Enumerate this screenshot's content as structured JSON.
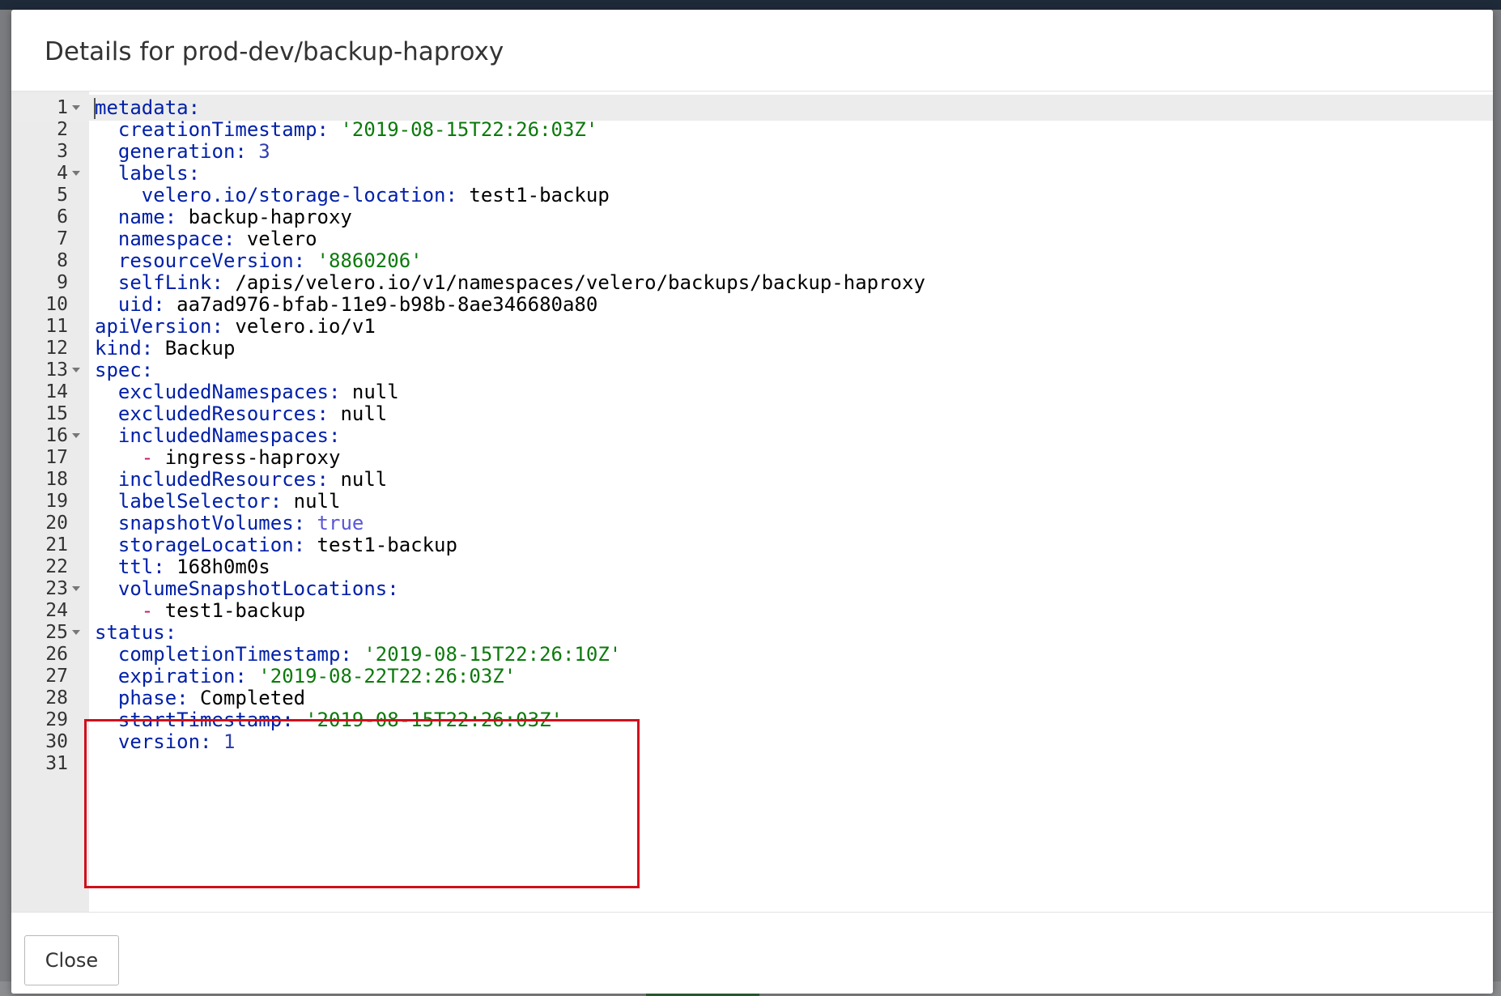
{
  "modal": {
    "title": "Details for prod-dev/backup-haproxy",
    "close_label": "Close"
  },
  "editor": {
    "lines": [
      {
        "n": "1",
        "fold": true,
        "parts": [
          {
            "t": "metadata:",
            "c": "k"
          }
        ]
      },
      {
        "n": "2",
        "fold": false,
        "parts": [
          {
            "t": "  creationTimestamp: ",
            "c": "k"
          },
          {
            "t": "'2019-08-15T22:26:03Z'",
            "c": "s"
          }
        ]
      },
      {
        "n": "3",
        "fold": false,
        "parts": [
          {
            "t": "  generation: ",
            "c": "k"
          },
          {
            "t": "3",
            "c": "n"
          }
        ]
      },
      {
        "n": "4",
        "fold": true,
        "parts": [
          {
            "t": "  labels:",
            "c": "k"
          }
        ]
      },
      {
        "n": "5",
        "fold": false,
        "parts": [
          {
            "t": "    velero.io/storage-location: ",
            "c": "k"
          },
          {
            "t": "test1-backup",
            "c": "p"
          }
        ]
      },
      {
        "n": "6",
        "fold": false,
        "parts": [
          {
            "t": "  name: ",
            "c": "k"
          },
          {
            "t": "backup-haproxy",
            "c": "p"
          }
        ]
      },
      {
        "n": "7",
        "fold": false,
        "parts": [
          {
            "t": "  namespace: ",
            "c": "k"
          },
          {
            "t": "velero",
            "c": "p"
          }
        ]
      },
      {
        "n": "8",
        "fold": false,
        "parts": [
          {
            "t": "  resourceVersion: ",
            "c": "k"
          },
          {
            "t": "'8860206'",
            "c": "s"
          }
        ]
      },
      {
        "n": "9",
        "fold": false,
        "parts": [
          {
            "t": "  selfLink: ",
            "c": "k"
          },
          {
            "t": "/apis/velero.io/v1/namespaces/velero/backups/backup-haproxy",
            "c": "p"
          }
        ]
      },
      {
        "n": "10",
        "fold": false,
        "parts": [
          {
            "t": "  uid: ",
            "c": "k"
          },
          {
            "t": "aa7ad976-bfab-11e9-b98b-8ae346680a80",
            "c": "p"
          }
        ]
      },
      {
        "n": "11",
        "fold": false,
        "parts": [
          {
            "t": "apiVersion: ",
            "c": "k"
          },
          {
            "t": "velero.io/v1",
            "c": "p"
          }
        ]
      },
      {
        "n": "12",
        "fold": false,
        "parts": [
          {
            "t": "kind: ",
            "c": "k"
          },
          {
            "t": "Backup",
            "c": "p"
          }
        ]
      },
      {
        "n": "13",
        "fold": true,
        "parts": [
          {
            "t": "spec:",
            "c": "k"
          }
        ]
      },
      {
        "n": "14",
        "fold": false,
        "parts": [
          {
            "t": "  excludedNamespaces: ",
            "c": "k"
          },
          {
            "t": "null",
            "c": "p"
          }
        ]
      },
      {
        "n": "15",
        "fold": false,
        "parts": [
          {
            "t": "  excludedResources: ",
            "c": "k"
          },
          {
            "t": "null",
            "c": "p"
          }
        ]
      },
      {
        "n": "16",
        "fold": true,
        "parts": [
          {
            "t": "  includedNamespaces:",
            "c": "k"
          }
        ]
      },
      {
        "n": "17",
        "fold": false,
        "parts": [
          {
            "t": "    ",
            "c": "p"
          },
          {
            "t": "-",
            "c": "d"
          },
          {
            "t": " ingress-haproxy",
            "c": "p"
          }
        ]
      },
      {
        "n": "18",
        "fold": false,
        "parts": [
          {
            "t": "  includedResources: ",
            "c": "k"
          },
          {
            "t": "null",
            "c": "p"
          }
        ]
      },
      {
        "n": "19",
        "fold": false,
        "parts": [
          {
            "t": "  labelSelector: ",
            "c": "k"
          },
          {
            "t": "null",
            "c": "p"
          }
        ]
      },
      {
        "n": "20",
        "fold": false,
        "parts": [
          {
            "t": "  snapshotVolumes: ",
            "c": "k"
          },
          {
            "t": "true",
            "c": "b"
          }
        ]
      },
      {
        "n": "21",
        "fold": false,
        "parts": [
          {
            "t": "  storageLocation: ",
            "c": "k"
          },
          {
            "t": "test1-backup",
            "c": "p"
          }
        ]
      },
      {
        "n": "22",
        "fold": false,
        "parts": [
          {
            "t": "  ttl: ",
            "c": "k"
          },
          {
            "t": "168h0m0s",
            "c": "p"
          }
        ]
      },
      {
        "n": "23",
        "fold": true,
        "parts": [
          {
            "t": "  volumeSnapshotLocations:",
            "c": "k"
          }
        ]
      },
      {
        "n": "24",
        "fold": false,
        "parts": [
          {
            "t": "    ",
            "c": "p"
          },
          {
            "t": "-",
            "c": "d"
          },
          {
            "t": " test1-backup",
            "c": "p"
          }
        ]
      },
      {
        "n": "25",
        "fold": true,
        "parts": [
          {
            "t": "status:",
            "c": "k"
          }
        ]
      },
      {
        "n": "26",
        "fold": false,
        "parts": [
          {
            "t": "  completionTimestamp: ",
            "c": "k"
          },
          {
            "t": "'2019-08-15T22:26:10Z'",
            "c": "s"
          }
        ]
      },
      {
        "n": "27",
        "fold": false,
        "parts": [
          {
            "t": "  expiration: ",
            "c": "k"
          },
          {
            "t": "'2019-08-22T22:26:03Z'",
            "c": "s"
          }
        ]
      },
      {
        "n": "28",
        "fold": false,
        "parts": [
          {
            "t": "  phase: ",
            "c": "k"
          },
          {
            "t": "Completed",
            "c": "p"
          }
        ]
      },
      {
        "n": "29",
        "fold": false,
        "parts": [
          {
            "t": "  startTimestamp: ",
            "c": "k"
          },
          {
            "t": "'2019-08-15T22:26:03Z'",
            "c": "s"
          }
        ]
      },
      {
        "n": "30",
        "fold": false,
        "parts": [
          {
            "t": "  version: ",
            "c": "k"
          },
          {
            "t": "1",
            "c": "n"
          }
        ]
      },
      {
        "n": "31",
        "fold": false,
        "parts": []
      }
    ]
  },
  "colors": {
    "key": "#001fa8",
    "string": "#0b7a0b",
    "number": "#2e3eb0",
    "boolean": "#5a57d6",
    "dash": "#c4176b",
    "highlight_border": "#d0101a"
  }
}
